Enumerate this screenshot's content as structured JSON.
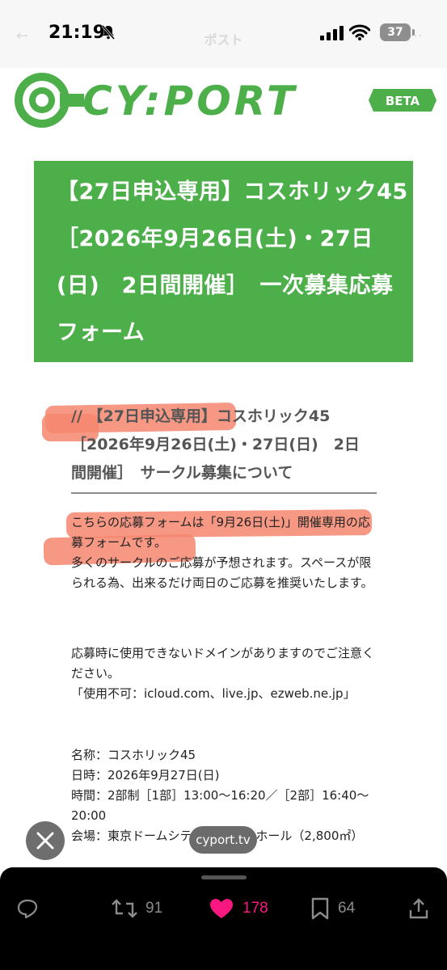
{
  "status_bar": {
    "time": "21:19",
    "battery": "37",
    "ghost_title": "ポスト"
  },
  "logo": {
    "text": "CY:PORT",
    "badge": "BETA",
    "color": "#4caf4a"
  },
  "banner": {
    "title": "【27日申込専用】コスホリック45［2026年9月26日(土)・27日(日)　2日間開催］　一次募集応募フォーム",
    "background": "#4caf4a"
  },
  "article": {
    "heading": "// 【27日申込専用】コスホリック45［2026年9月26日(土)・27日(日)　2日間開催］　サークル募集について",
    "intro": "こちらの応募フォームは「9月26日(土)」開催専用の応募フォームです。\n多くのサークルのご応募が予想されます。スペースが限られる為、出来るだけ両日のご応募を推奨いたします。",
    "domain_notice": "応募時に使用できないドメインがありますのでご注意ください。\n「使用不可：icloud.com、live.jp、ezweb.ne.jp」",
    "details": "名称：コスホリック45\n日時：2026年9月27日(日)\n時間：2部制［1部］13:00〜16:20／［2部］16:40〜20:00\n会場：東京ドームシティ プリズムホール（2,800㎡）"
  },
  "overlay": {
    "url": "cyport.tv",
    "close_icon": "close-icon"
  },
  "actions": {
    "reply_icon": "reply-icon",
    "repost_count": "91",
    "like_count": "178",
    "bookmark_count": "64",
    "share_icon": "share-icon",
    "like_color": "#f91880",
    "icon_color": "#8b8b8b"
  }
}
